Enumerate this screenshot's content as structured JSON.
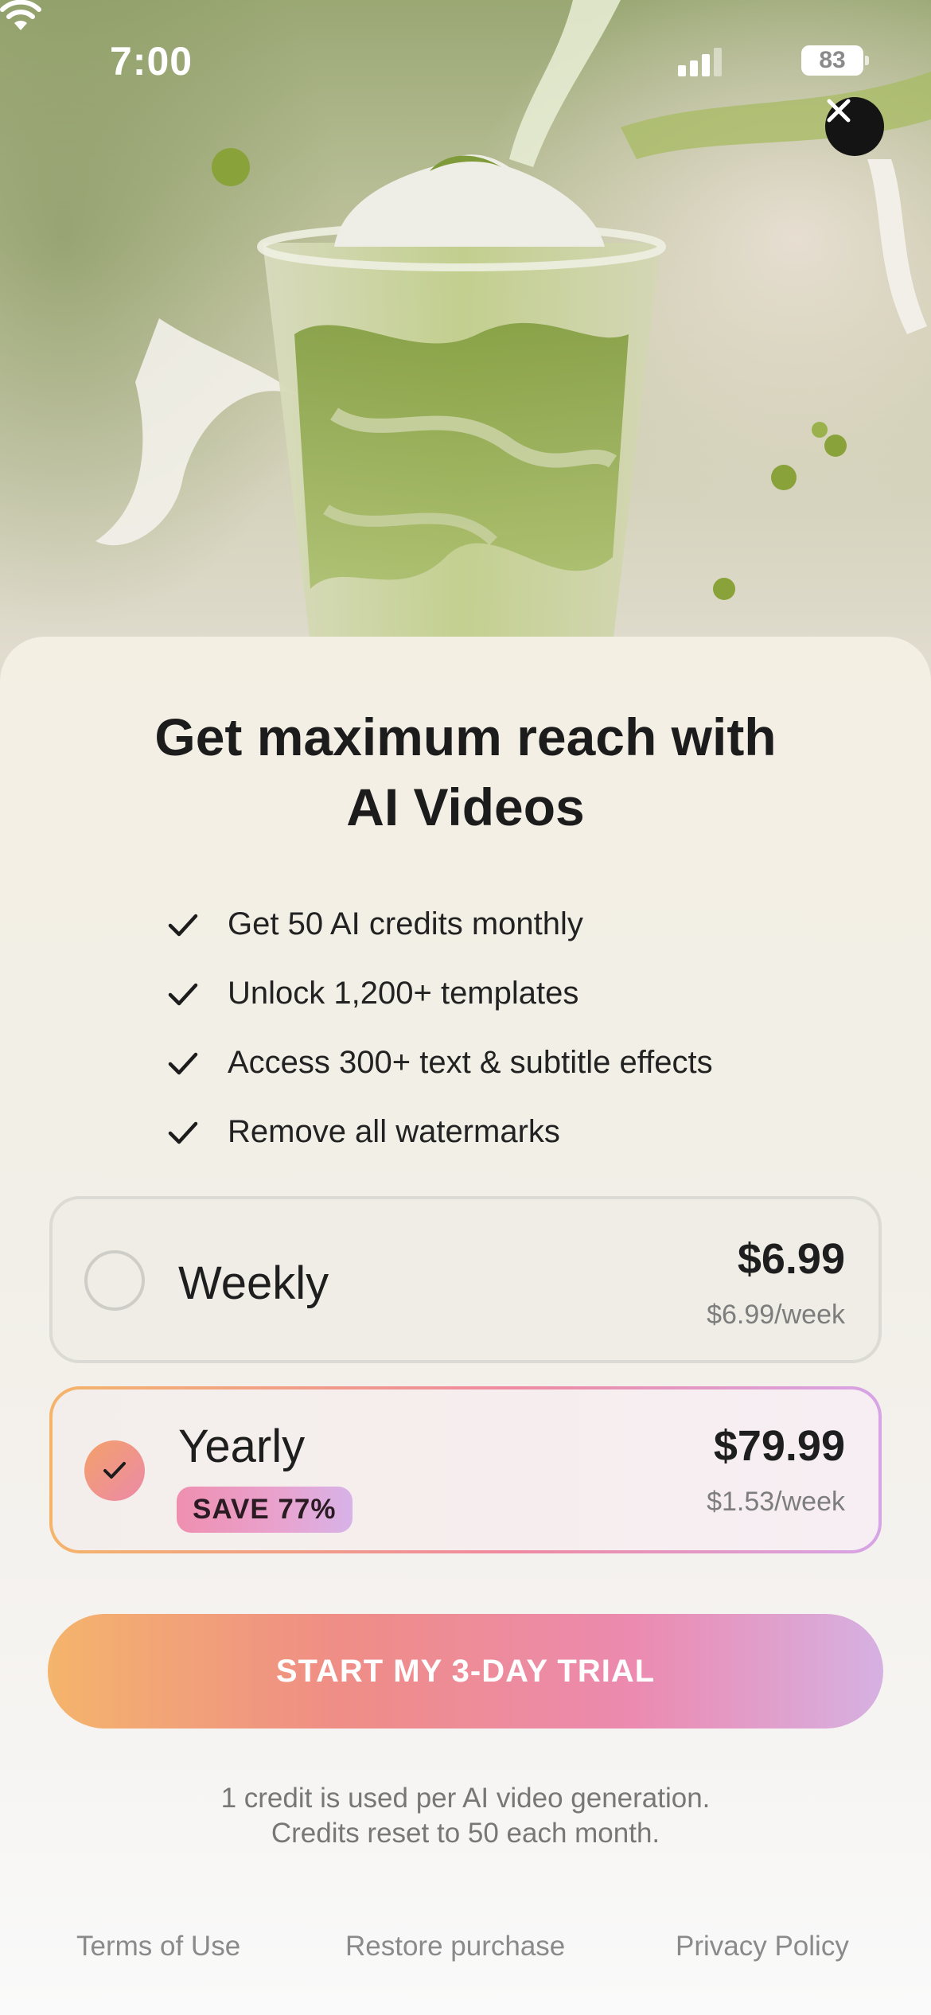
{
  "status_bar": {
    "time": "7:00",
    "battery": "83"
  },
  "hero": {
    "image": "matcha latte with milk splash",
    "close_icon": "close-icon"
  },
  "headline": {
    "line1": "Get maximum reach with",
    "line2": "AI Videos"
  },
  "features": [
    "Get 50 AI credits monthly",
    "Unlock 1,200+ templates",
    "Access 300+ text & subtitle effects",
    "Remove all watermarks"
  ],
  "plans": {
    "weekly": {
      "name": "Weekly",
      "price": "$6.99",
      "per_week": "$6.99/week",
      "selected": false
    },
    "yearly": {
      "name": "Yearly",
      "badge": "SAVE 77%",
      "price": "$79.99",
      "per_week": "$1.53/week",
      "selected": true
    }
  },
  "cta": {
    "label": "START MY 3-DAY TRIAL"
  },
  "fineprint": {
    "line1": "1 credit is used per AI video generation.",
    "line2": "Credits reset to 50 each month."
  },
  "footer": {
    "terms": "Terms of Use",
    "restore": "Restore purchase",
    "privacy": "Privacy Policy"
  },
  "colors": {
    "cta_start": "#f4b46c",
    "cta_mid": "#ec8ab0",
    "cta_end": "#d6b1e2",
    "accent_pink": "#ef8aa0",
    "text_dark": "#1c1c1c"
  }
}
